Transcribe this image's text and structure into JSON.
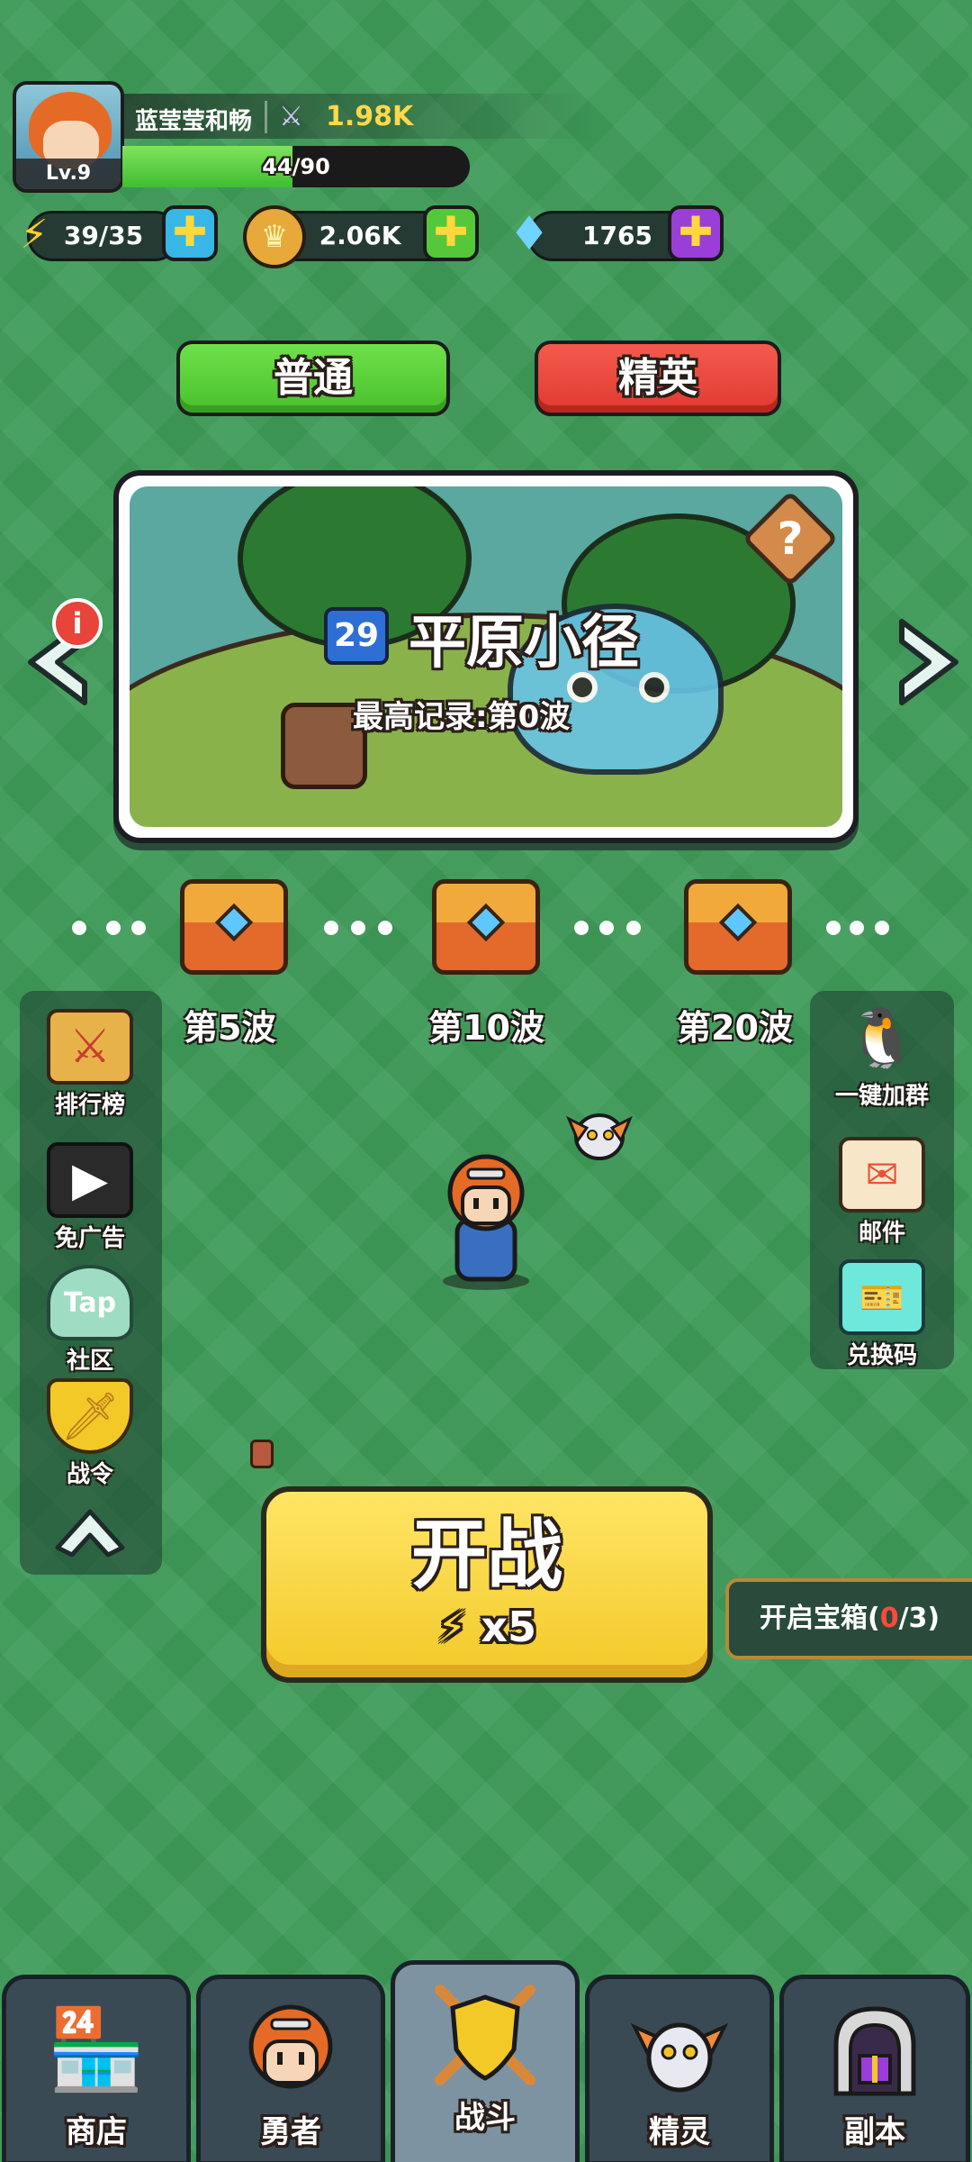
{
  "player": {
    "name": "蓝莹莹和畅",
    "level": "Lv.9",
    "power": "1.98K",
    "xp_text": "44/90",
    "xp_fraction": 0.49
  },
  "resources": {
    "energy": "39/35",
    "gold": "2.06K",
    "gems": "1765"
  },
  "modes": {
    "normal": "普通",
    "elite": "精英"
  },
  "stage": {
    "number": "29",
    "name": "平原小径",
    "record": "最高记录:第0波"
  },
  "waves": [
    {
      "label": "第5波"
    },
    {
      "label": "第10波"
    },
    {
      "label": "第20波"
    }
  ],
  "left_menu": {
    "ranking": "排行榜",
    "no_ads": "免广告",
    "community": "社区",
    "community_icon_text": "Tap",
    "battle_pass": "战令"
  },
  "right_menu": {
    "join_group": "一键加群",
    "mail": "邮件",
    "redeem": "兑换码"
  },
  "start": {
    "label": "开战",
    "cost": "x5"
  },
  "open_chest": {
    "prefix": "开启宝箱(",
    "count": "0",
    "suffix": "/3)"
  },
  "nav": {
    "shop": "商店",
    "hero": "勇者",
    "battle": "战斗",
    "spirit": "精灵",
    "dungeon": "副本"
  },
  "colors": {
    "background": "#3e9b59",
    "normal_button": "#57d23c",
    "elite_button": "#ef4a3e",
    "start_button": "#f3c928",
    "gold_text": "#ffd84d"
  }
}
